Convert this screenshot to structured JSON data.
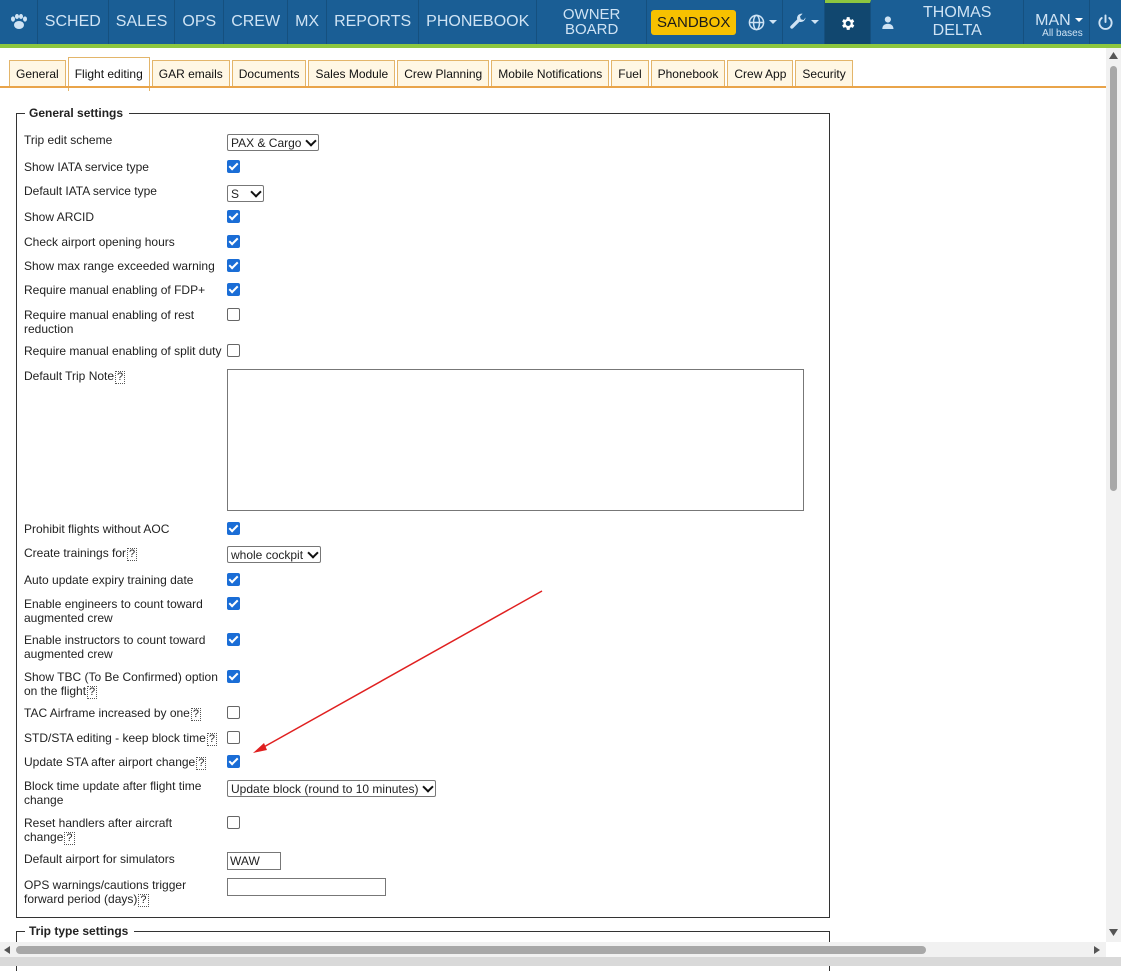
{
  "nav": {
    "items": [
      "SCHED",
      "SALES",
      "OPS",
      "CREW",
      "MX",
      "REPORTS",
      "PHONEBOOK"
    ],
    "owner_line1": "OWNER",
    "owner_line2": "BOARD",
    "sandbox": "SANDBOX",
    "user": "THOMAS DELTA",
    "man": "MAN",
    "man_sub": "All bases"
  },
  "tabs": [
    "General",
    "Flight editing",
    "GAR emails",
    "Documents",
    "Sales Module",
    "Crew Planning",
    "Mobile Notifications",
    "Fuel",
    "Phonebook",
    "Crew App",
    "Security"
  ],
  "active_tab": "Flight editing",
  "general": {
    "legend": "General settings",
    "trip_edit_scheme": {
      "label": "Trip edit scheme",
      "value": "PAX & Cargo"
    },
    "show_iata": {
      "label": "Show IATA service type",
      "checked": true
    },
    "default_iata": {
      "label": "Default IATA service type",
      "value": "S"
    },
    "show_arcid": {
      "label": "Show ARCID",
      "checked": true
    },
    "check_airport": {
      "label": "Check airport opening hours",
      "checked": true
    },
    "max_range": {
      "label": "Show max range exceeded warning",
      "checked": true
    },
    "fdp": {
      "label": "Require manual enabling of FDP+",
      "checked": true
    },
    "rest_reduction": {
      "label": "Require manual enabling of rest reduction",
      "checked": false
    },
    "split_duty": {
      "label": "Require manual enabling of split duty",
      "checked": false
    },
    "trip_note": {
      "label": "Default Trip Note",
      "help": "?"
    },
    "aoc": {
      "label": "Prohibit flights without AOC",
      "checked": true
    },
    "trainings": {
      "label": "Create trainings for",
      "help": "?",
      "value": "whole cockpit"
    },
    "expiry": {
      "label": "Auto update expiry training date",
      "checked": true
    },
    "engineers": {
      "label": "Enable engineers to count toward augmented crew",
      "checked": true
    },
    "instructors": {
      "label": "Enable instructors to count toward augmented crew",
      "checked": true
    },
    "tbc": {
      "label": "Show TBC (To Be Confirmed) option on the flight",
      "help": "?",
      "checked": true
    },
    "tac": {
      "label": "TAC Airframe increased by one",
      "help": "?",
      "checked": false
    },
    "std_sta": {
      "label": "STD/STA editing - keep block time",
      "help": "?",
      "checked": false
    },
    "update_sta": {
      "label": "Update STA after airport change",
      "help": "?",
      "checked": true
    },
    "block_update": {
      "label": "Block time update after flight time change",
      "value": "Update block (round to 10 minutes)"
    },
    "reset_handlers": {
      "label": "Reset handlers after aircraft change",
      "help": "?",
      "checked": false
    },
    "sim_airport": {
      "label": "Default airport for simulators",
      "value": "WAW"
    },
    "ops_warnings": {
      "label": "OPS warnings/cautions trigger forward period (days)",
      "help": "?",
      "value": ""
    }
  },
  "trip_type": {
    "legend": "Trip type settings"
  },
  "colors": {
    "nav_bg": "#1a5e95",
    "accent_green": "#8dc63f",
    "sandbox": "#f7c100",
    "tab_border": "#e9a44a",
    "checkbox": "#1a6dd6",
    "annotation_arrow": "#e02020"
  }
}
